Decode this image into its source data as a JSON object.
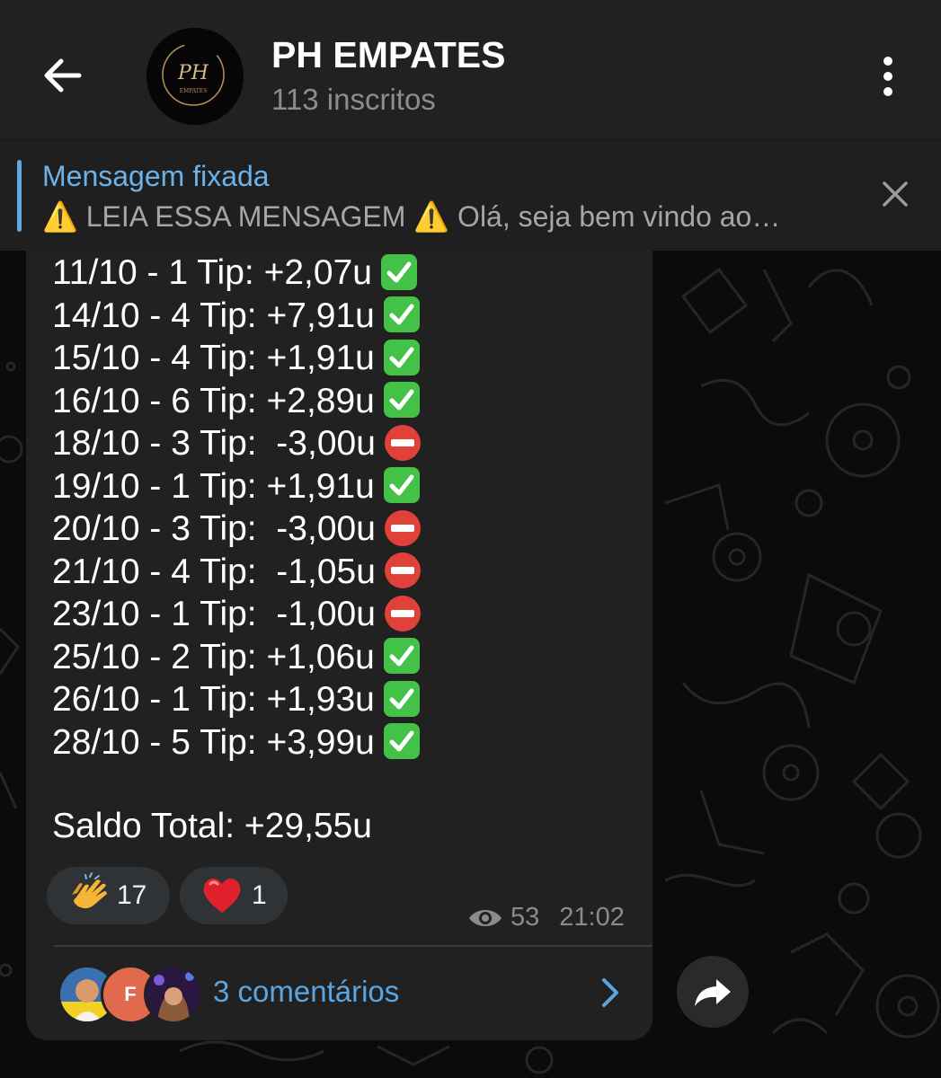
{
  "header": {
    "back_icon": "arrow-left-icon",
    "channel_logo_text": "PH",
    "channel_logo_sub": "EMPATES",
    "title": "PH EMPATES",
    "subtitle": "113 inscritos",
    "menu_icon": "more-vertical-icon"
  },
  "pinned": {
    "title": "Mensagem fixada",
    "text": "⚠️ LEIA ESSA MENSAGEM ⚠️  Olá, seja bem vindo ao…",
    "close_icon": "close-icon"
  },
  "message": {
    "lines": [
      {
        "text": "11/10 - 1 Tip: +2,07u",
        "status": "win"
      },
      {
        "text": "14/10 - 4 Tip: +7,91u",
        "status": "win"
      },
      {
        "text": "15/10 - 4 Tip: +1,91u",
        "status": "win"
      },
      {
        "text": "16/10 - 6 Tip: +2,89u",
        "status": "win"
      },
      {
        "text": "18/10 - 3 Tip:  -3,00u",
        "status": "loss"
      },
      {
        "text": "19/10 - 1 Tip: +1,91u",
        "status": "win"
      },
      {
        "text": "20/10 - 3 Tip:  -3,00u",
        "status": "loss"
      },
      {
        "text": "21/10 - 4 Tip:  -1,05u",
        "status": "loss"
      },
      {
        "text": "23/10 - 1 Tip:  -1,00u",
        "status": "loss"
      },
      {
        "text": "25/10 - 2 Tip: +1,06u",
        "status": "win"
      },
      {
        "text": "26/10 - 1 Tip: +1,93u",
        "status": "win"
      },
      {
        "text": "28/10 - 5 Tip: +3,99u",
        "status": "win"
      }
    ],
    "total": "Saldo Total: +29,55u",
    "reactions": [
      {
        "emoji": "clapping-hands",
        "count": "17"
      },
      {
        "emoji": "red-heart",
        "count": "1"
      }
    ],
    "views": "53",
    "time": "21:02",
    "comments": {
      "avatar_letter": "F",
      "label": "3 comentários"
    }
  },
  "colors": {
    "header_bg": "#212121",
    "bubble_bg": "#212121",
    "accent": "#5aa6e3",
    "win": "#44c247",
    "loss": "#e0423a"
  }
}
